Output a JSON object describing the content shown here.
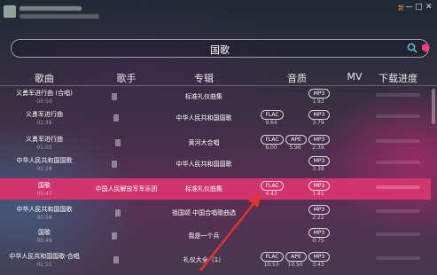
{
  "window": {
    "new_badge": "新",
    "minimize": "—",
    "maximize": "□",
    "close": "✕"
  },
  "search": {
    "query": "国歌"
  },
  "header": {
    "song": "歌曲",
    "artist": "歌手",
    "album": "专辑",
    "quality": "音质",
    "mv": "MV",
    "download": "下载进度"
  },
  "rows": [
    {
      "title": "义勇军进行曲 (合唱)",
      "duration": "00:50",
      "artist": "",
      "album": "标准礼仪曲集",
      "flac": "",
      "ape": "",
      "mp3": "MP3",
      "flac_size": "",
      "ape_size": "",
      "mp3_size": "1.93"
    },
    {
      "title": "义勇军进行曲",
      "duration": "01:39",
      "artist": "",
      "album": "中华人民共和国国歌",
      "flac": "FLAC",
      "ape": "",
      "mp3": "MP3",
      "flac_size": "9.64",
      "ape_size": "",
      "mp3_size": "3.79"
    },
    {
      "title": "义勇军进行曲",
      "duration": "01:02",
      "artist": "",
      "album": "黄河大合唱",
      "flac": "FLAC",
      "ape": "APE",
      "mp3": "MP3",
      "flac_size": "6.00",
      "ape_size": "5.96",
      "mp3_size": "2.39"
    },
    {
      "title": "中华人民共和国国歌",
      "duration": "01:28",
      "artist": "",
      "album": "中华人民共和国国歌",
      "flac": "",
      "ape": "",
      "mp3": "MP3",
      "flac_size": "",
      "ape_size": "",
      "mp3_size": "3.38"
    },
    {
      "title": "国歌",
      "duration": "00:47",
      "artist": "中国人民解放军军乐团",
      "album": "标准礼仪曲集",
      "flac": "FLAC",
      "ape": "",
      "mp3": "MP3",
      "flac_size": "4.43",
      "ape_size": "",
      "mp3_size": "1.81"
    },
    {
      "title": "中华人民共和国国歌",
      "duration": "00:58",
      "artist": "",
      "album": "祖国颂 中国合唱歌曲选",
      "flac": "",
      "ape": "",
      "mp3": "MP3",
      "flac_size": "",
      "ape_size": "",
      "mp3_size": "2.22"
    },
    {
      "title": "国歌",
      "duration": "00:49",
      "artist": "",
      "album": "我是一个兵",
      "flac": "",
      "ape": "",
      "mp3": "MP3",
      "flac_size": "",
      "ape_size": "",
      "mp3_size": "0.75"
    },
    {
      "title": "中华人民共和国国歌-合唱",
      "duration": "01:51",
      "artist": "",
      "album": "礼仪大全（1）",
      "flac": "FLAC",
      "ape": "APE",
      "mp3": "MP3",
      "flac_size": "10.53",
      "ape_size": "10.50",
      "mp3_size": "3.43"
    }
  ],
  "colors": {
    "selected_row": "#d2356d",
    "annotation_arrow": "#e8302a",
    "search_pink": "#ff3a7a"
  },
  "icons": [
    "search-icon",
    "pink-tag-icon",
    "minimize-icon",
    "maximize-icon",
    "close-icon",
    "avatar-icon"
  ]
}
